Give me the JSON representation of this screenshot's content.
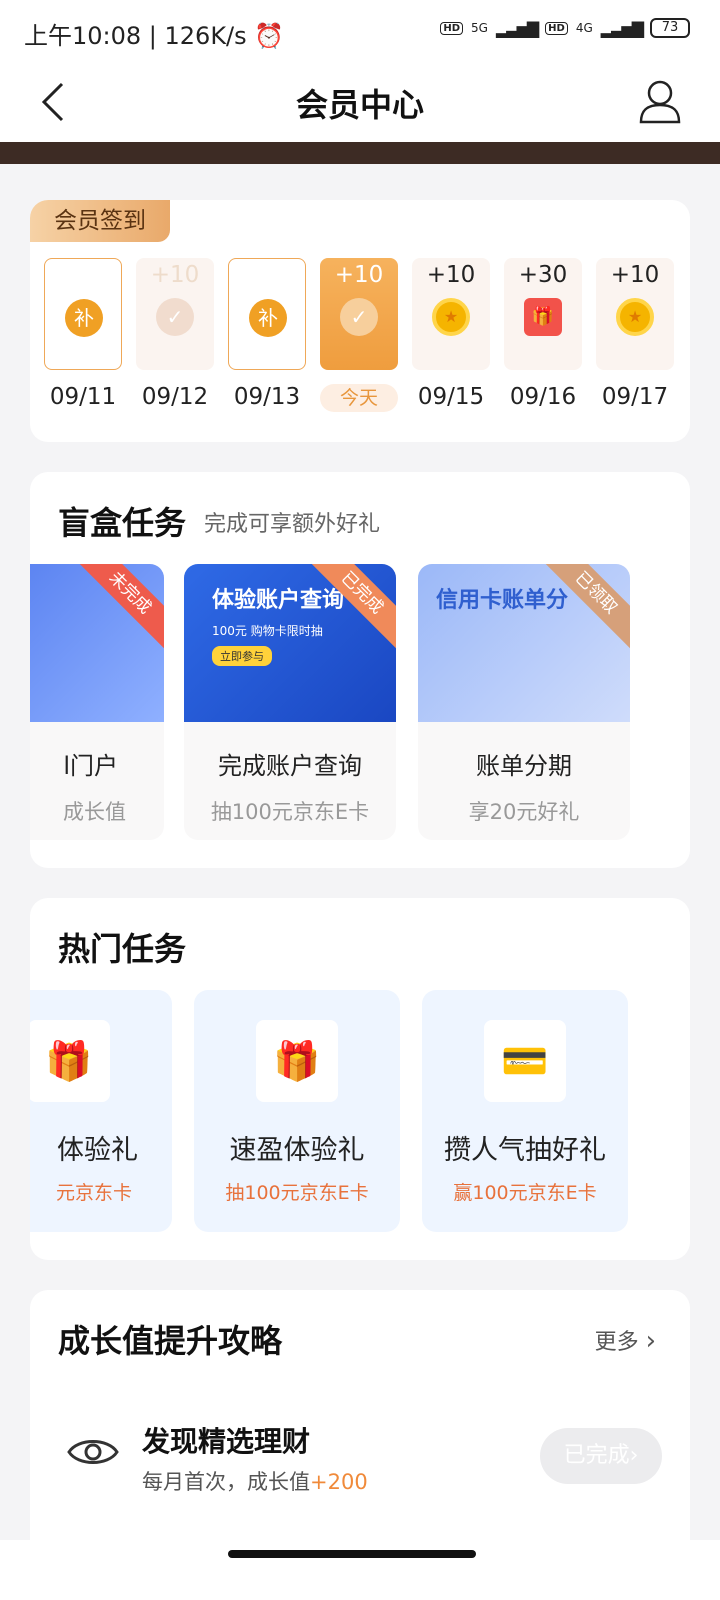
{
  "status_bar": {
    "time": "上午10:08 | 126K/s ⏰",
    "network1": "5G",
    "network2": "4G",
    "battery": "73"
  },
  "nav": {
    "title": "会员中心"
  },
  "checkin": {
    "badge": "会员签到",
    "days": [
      {
        "date": "09/11",
        "points": "",
        "icon": "补"
      },
      {
        "date": "09/12",
        "points": "+10",
        "icon": "✓"
      },
      {
        "date": "09/13",
        "points": "",
        "icon": "补"
      },
      {
        "date": "今天",
        "points": "+10",
        "icon": "✓"
      },
      {
        "date": "09/15",
        "points": "+10",
        "icon": "★"
      },
      {
        "date": "09/16",
        "points": "+30",
        "icon": "🎁"
      },
      {
        "date": "09/17",
        "points": "+10",
        "icon": "★"
      }
    ]
  },
  "blind_box": {
    "title": "盲盒任务",
    "subtitle": "完成可享额外好礼",
    "items": [
      {
        "title": "l门户",
        "sub": "成长值",
        "status": "未完成",
        "headline": "",
        "img_sub": "",
        "pill": ""
      },
      {
        "title": "完成账户查询",
        "sub": "抽100元京东E卡",
        "status": "已完成",
        "headline": "体验账户查询",
        "img_sub": "100元 购物卡限时抽",
        "pill": "立即参与"
      },
      {
        "title": "账单分期",
        "sub": "享20元好礼",
        "status": "已领取",
        "headline": "信用卡账单分",
        "img_sub": "",
        "pill": ""
      }
    ]
  },
  "hot_tasks": {
    "title": "热门任务",
    "items": [
      {
        "title": "体验礼",
        "sub": "元京东卡",
        "icon": "🎁"
      },
      {
        "title": "速盈体验礼",
        "sub": "抽100元京东E卡",
        "icon": "🎁"
      },
      {
        "title": "攒人气抽好礼",
        "sub": "赢100元京东E卡",
        "icon": "💳"
      }
    ]
  },
  "growth": {
    "title": "成长值提升攻略",
    "more": "更多",
    "item_title": "发现精选理财",
    "item_sub": "每月首次，成长值",
    "item_plus": "+200",
    "button": "已完成"
  }
}
